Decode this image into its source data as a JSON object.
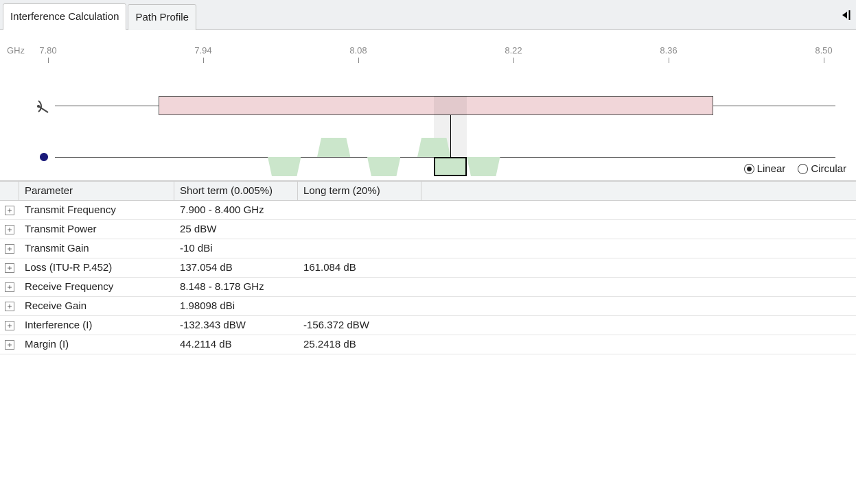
{
  "tabs": [
    {
      "label": "Interference Calculation",
      "active": true
    },
    {
      "label": "Path Profile",
      "active": false
    }
  ],
  "axis": {
    "unit": "GHz",
    "ticks": [
      "7.80",
      "7.94",
      "8.08",
      "8.22",
      "8.36",
      "8.50"
    ]
  },
  "polarization": {
    "options": [
      "Linear",
      "Circular"
    ],
    "selected": "Linear"
  },
  "chart_data": {
    "type": "bar",
    "title": "",
    "xlabel": "GHz",
    "ylabel": "",
    "x_range": [
      7.8,
      8.5
    ],
    "tracks": [
      {
        "name": "transmit",
        "band": {
          "start": 7.9,
          "end": 8.4
        }
      },
      {
        "name": "receive",
        "channels": [
          {
            "center": 8.013,
            "width": 0.03,
            "offset": "below"
          },
          {
            "center": 8.058,
            "width": 0.03,
            "offset": "above"
          },
          {
            "center": 8.103,
            "width": 0.03,
            "offset": "below"
          },
          {
            "center": 8.148,
            "width": 0.03,
            "offset": "above"
          },
          {
            "center": 8.163,
            "width": 0.03,
            "offset": "below",
            "selected": true
          },
          {
            "center": 8.193,
            "width": 0.03,
            "offset": "below"
          }
        ],
        "selected_band": {
          "start": 8.148,
          "end": 8.178
        }
      }
    ]
  },
  "table": {
    "headers": {
      "parameter": "Parameter",
      "short": "Short term (0.005%)",
      "long": "Long term (20%)"
    },
    "rows": [
      {
        "param": "Transmit Frequency",
        "short": "7.900 - 8.400 GHz",
        "long": ""
      },
      {
        "param": "Transmit Power",
        "short": "25 dBW",
        "long": ""
      },
      {
        "param": "Transmit Gain",
        "short": "-10 dBi",
        "long": ""
      },
      {
        "param": "Loss (ITU-R P.452)",
        "short": "137.054 dB",
        "long": "161.084 dB"
      },
      {
        "param": "Receive Frequency",
        "short": "8.148 - 8.178 GHz",
        "long": ""
      },
      {
        "param": "Receive Gain",
        "short": "1.98098 dBi",
        "long": ""
      },
      {
        "param": "Interference (I)",
        "short": "-132.343 dBW",
        "long": "-156.372 dBW"
      },
      {
        "param": "Margin (I)",
        "short": "44.2114 dB",
        "long": "25.2418 dB"
      }
    ]
  }
}
